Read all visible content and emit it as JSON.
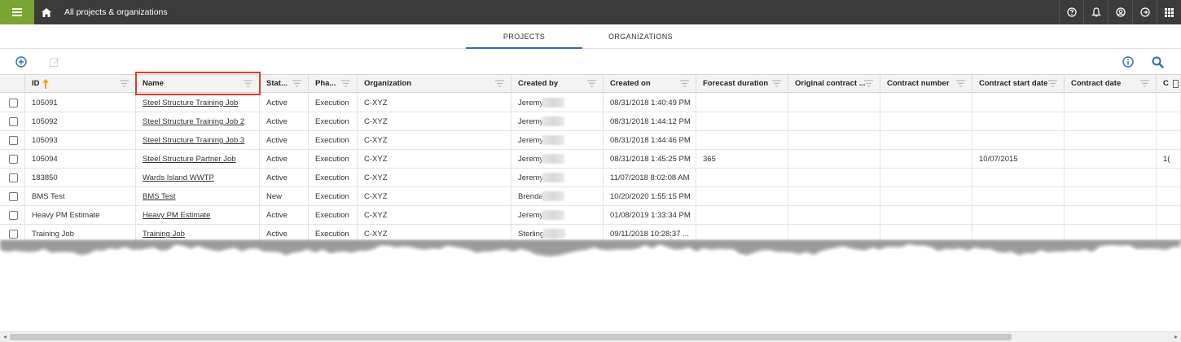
{
  "topbar": {
    "title": "All projects & organizations",
    "icons": [
      "help-icon",
      "bell-icon",
      "user-icon",
      "logout-icon",
      "apps-grid-icon"
    ]
  },
  "tabs": [
    {
      "label": "PROJECTS",
      "active": true
    },
    {
      "label": "ORGANIZATIONS",
      "active": false
    }
  ],
  "toolbar": {
    "icons": [
      "add-circle-icon",
      "edit-icon",
      "info-icon",
      "search-icon"
    ]
  },
  "colors": {
    "accent": "#2c6fb0",
    "menu_green": "#7aa532",
    "topbar_bg": "#3b3b3b",
    "highlight_red": "#e53935",
    "sort_arrow": "#f0a500"
  },
  "grid": {
    "columns": [
      {
        "key": "id",
        "label": "ID",
        "sorted": "asc"
      },
      {
        "key": "name",
        "label": "Name"
      },
      {
        "key": "status",
        "label": "Stat..."
      },
      {
        "key": "phase",
        "label": "Pha..."
      },
      {
        "key": "organization",
        "label": "Organization"
      },
      {
        "key": "created_by",
        "label": "Created by"
      },
      {
        "key": "created_on",
        "label": "Created on"
      },
      {
        "key": "forecast_duration",
        "label": "Forecast duration"
      },
      {
        "key": "original_contract",
        "label": "Original contract ..."
      },
      {
        "key": "contract_number",
        "label": "Contract number"
      },
      {
        "key": "contract_start_date",
        "label": "Contract start date"
      },
      {
        "key": "contract_date",
        "label": "Contract date"
      },
      {
        "key": "more",
        "label": "C"
      }
    ],
    "rows": [
      {
        "id": "105091",
        "name": "Steel Structure Training Job",
        "status": "Active",
        "phase": "Execution",
        "organization": "C-XYZ",
        "created_by": "Jeremy",
        "created_on": "08/31/2018 1:40:49 PM",
        "forecast_duration": "",
        "original_contract": "",
        "contract_number": "",
        "contract_start_date": "",
        "contract_date": "",
        "more": ""
      },
      {
        "id": "105092",
        "name": "Steel Structure Training Job 2",
        "status": "Active",
        "phase": "Execution",
        "organization": "C-XYZ",
        "created_by": "Jeremy",
        "created_on": "08/31/2018 1:44:12 PM",
        "forecast_duration": "",
        "original_contract": "",
        "contract_number": "",
        "contract_start_date": "",
        "contract_date": "",
        "more": ""
      },
      {
        "id": "105093",
        "name": "Steel Structure Training Job 3",
        "status": "Active",
        "phase": "Execution",
        "organization": "C-XYZ",
        "created_by": "Jeremy",
        "created_on": "08/31/2018 1:44:46 PM",
        "forecast_duration": "",
        "original_contract": "",
        "contract_number": "",
        "contract_start_date": "",
        "contract_date": "",
        "more": ""
      },
      {
        "id": "105094",
        "name": "Steel Structure Partner Job",
        "status": "Active",
        "phase": "Execution",
        "organization": "C-XYZ",
        "created_by": "Jeremy",
        "created_on": "08/31/2018 1:45:25 PM",
        "forecast_duration": "365",
        "original_contract": "",
        "contract_number": "",
        "contract_start_date": "10/07/2015",
        "contract_date": "",
        "more": "1("
      },
      {
        "id": "183850",
        "name": "Wards Island WWTP",
        "status": "Active",
        "phase": "Execution",
        "organization": "C-XYZ",
        "created_by": "Jeremy",
        "created_on": "11/07/2018 8:02:08 AM",
        "forecast_duration": "",
        "original_contract": "",
        "contract_number": "",
        "contract_start_date": "",
        "contract_date": "",
        "more": ""
      },
      {
        "id": "BMS Test",
        "name": "BMS Test",
        "status": "New",
        "phase": "Execution",
        "organization": "C-XYZ",
        "created_by": "Brenda",
        "created_on": "10/20/2020 1:55:15 PM",
        "forecast_duration": "",
        "original_contract": "",
        "contract_number": "",
        "contract_start_date": "",
        "contract_date": "",
        "more": ""
      },
      {
        "id": "Heavy PM Estimate",
        "name": "Heavy PM Estimate",
        "status": "Active",
        "phase": "Execution",
        "organization": "C-XYZ",
        "created_by": "Jeremy",
        "created_on": "01/08/2019 1:33:34 PM",
        "forecast_duration": "",
        "original_contract": "",
        "contract_number": "",
        "contract_start_date": "",
        "contract_date": "",
        "more": ""
      },
      {
        "id": "Training Job",
        "name": "Training Job",
        "status": "Active",
        "phase": "Execution",
        "organization": "C-XYZ",
        "created_by": "Sterling",
        "created_on": "09/11/2018 10:28:37 ...",
        "forecast_duration": "",
        "original_contract": "",
        "contract_number": "",
        "contract_start_date": "",
        "contract_date": "",
        "more": ""
      }
    ]
  }
}
